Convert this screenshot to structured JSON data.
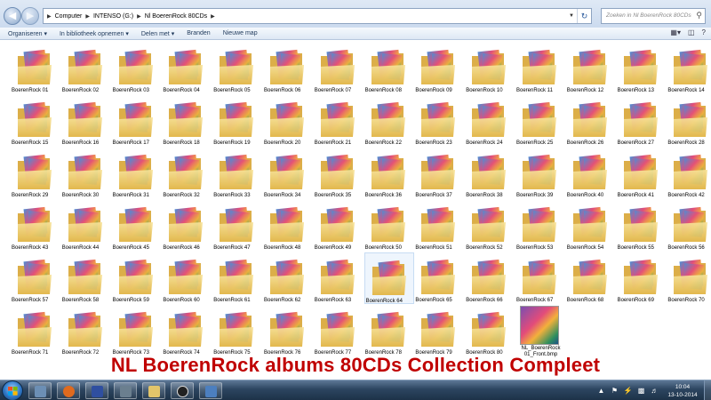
{
  "addressbar": {
    "segments": [
      "Computer",
      "INTENSO (G:)",
      "Nl BoerenRock 80CDs"
    ],
    "search_placeholder": "Zoeken in Nl BoerenRock 80CDs"
  },
  "toolbar": {
    "organize": "Organiseren ▾",
    "library": "In bibliotheek opnemen ▾",
    "share": "Delen met ▾",
    "burn": "Branden",
    "new_folder": "Nieuwe map"
  },
  "folders": [
    "BoerenRock 01",
    "BoerenRock 02",
    "BoerenRock 03",
    "BoerenRock 04",
    "BoerenRock 05",
    "BoerenRock 06",
    "BoerenRock 07",
    "BoerenRock 08",
    "BoerenRock 09",
    "BoerenRock 10",
    "BoerenRock 11",
    "BoerenRock 12",
    "BoerenRock 13",
    "BoerenRock 14",
    "BoerenRock 15",
    "BoerenRock 16",
    "BoerenRock 17",
    "BoerenRock 18",
    "BoerenRock 19",
    "BoerenRock 20",
    "BoerenRock 21",
    "BoerenRock 22",
    "BoerenRock 23",
    "BoerenRock 24",
    "BoerenRock 25",
    "BoerenRock 26",
    "BoerenRock 27",
    "BoerenRock 28",
    "BoerenRock 29",
    "BoerenRock 30",
    "BoerenRock 31",
    "BoerenRock 32",
    "BoerenRock 33",
    "BoerenRock 34",
    "BoerenRock 35",
    "BoerenRock 36",
    "BoerenRock 37",
    "BoerenRock 38",
    "BoerenRock 39",
    "BoerenRock 40",
    "BoerenRock 41",
    "BoerenRock 42",
    "BoerenRock 43",
    "BoerenRock 44",
    "BoerenRock 45",
    "BoerenRock 46",
    "BoerenRock 47",
    "BoerenRock 48",
    "BoerenRock 49",
    "BoerenRock 50",
    "BoerenRock 51",
    "BoerenRock 52",
    "BoerenRock 53",
    "BoerenRock 54",
    "BoerenRock 55",
    "BoerenRock 56",
    "BoerenRock 57",
    "BoerenRock 58",
    "BoerenRock 59",
    "BoerenRock 60",
    "BoerenRock 61",
    "BoerenRock 62",
    "BoerenRock 63",
    "BoerenRock 64",
    "BoerenRock 65",
    "BoerenRock 66",
    "BoerenRock 67",
    "BoerenRock 68",
    "BoerenRock 69",
    "BoerenRock 70",
    "BoerenRock 71",
    "BoerenRock 72",
    "BoerenRock 73",
    "BoerenRock 74",
    "BoerenRock 75",
    "BoerenRock 76",
    "BoerenRock 77",
    "BoerenRock 78",
    "BoerenRock 79",
    "BoerenRock 80"
  ],
  "image_file": {
    "label_line1": "NL_BoerenRock",
    "label_line2": "01_Front.bmp"
  },
  "selected_folder": "BoerenRock 64",
  "caption": "NL BoerenRock albums 80CDs Collection Compleet",
  "taskbar": {
    "time": "10:04",
    "date": "13-10-2014",
    "apps": [
      "explorer-icon",
      "firefox-icon",
      "media-player-icon",
      "network-tool-icon",
      "folder-icon",
      "smiley-icon",
      "image-viewer-icon"
    ]
  },
  "colors": {
    "caption": "#c00000",
    "folder": "#f2d67a",
    "taskbar": "#2c4560"
  }
}
